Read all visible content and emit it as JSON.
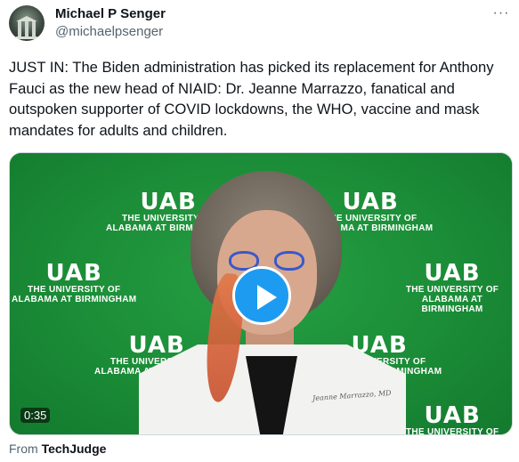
{
  "author": {
    "name": "Michael P Senger",
    "handle": "@michaelpsenger"
  },
  "menu": {
    "more_label": "···"
  },
  "tweet": {
    "text": "JUST IN: The Biden administration has picked its replacement for Anthony Fauci as the new head of NIAID: Dr. Jeanne Marrazzo, fanatical and outspoken supporter of COVID lockdowns, the WHO, vaccine and mask mandates for adults and children."
  },
  "video": {
    "duration": "0:35",
    "backdrop_logo": {
      "mark": "UAB",
      "line1": "THE UNIVERSITY OF",
      "line2": "ALABAMA AT BIRMINGHAM"
    },
    "name_tag": "Jeanne Marrazzo, MD",
    "colors": {
      "backdrop": "#1b8c37",
      "play_button": "#1d9bf0"
    }
  },
  "source": {
    "prefix": "From",
    "name": "TechJudge"
  },
  "icons": [
    "more-icon",
    "play-icon"
  ]
}
